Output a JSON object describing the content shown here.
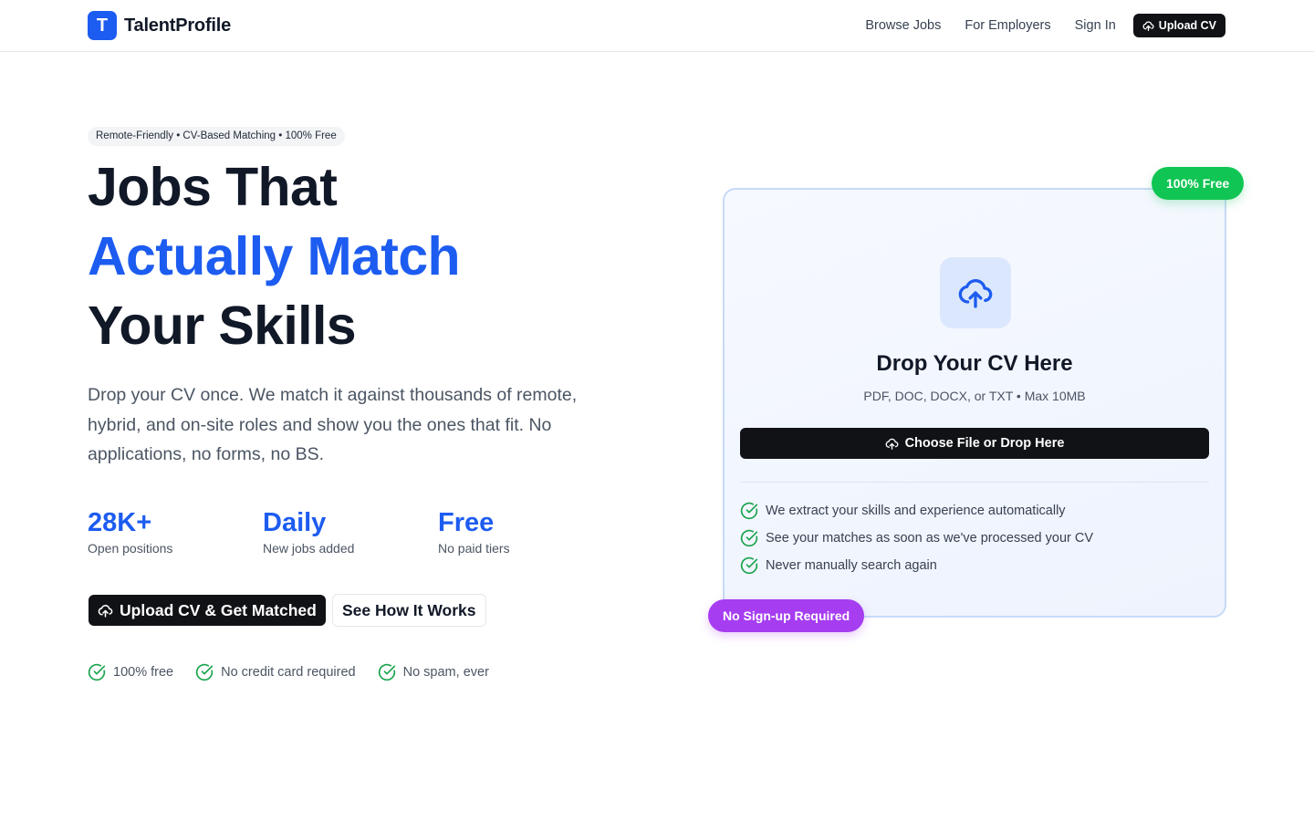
{
  "brand": {
    "logo_letter": "T",
    "name": "TalentProfile",
    "color": "#1d5cf0"
  },
  "nav": {
    "links": [
      "Browse Jobs",
      "For Employers",
      "Sign In"
    ],
    "cta": "Upload CV"
  },
  "hero": {
    "tagline": "Remote-Friendly • CV-Based Matching • 100% Free",
    "headline_line1": "Jobs That",
    "headline_line2": "Actually Match",
    "headline_line3": "Your Skills",
    "lead": "Drop your CV once. We match it against thousands of remote, hybrid, and on-site roles and show you the ones that fit. No applications, no forms, no BS.",
    "stats": [
      {
        "value": "28K+",
        "label": "Open positions"
      },
      {
        "value": "Daily",
        "label": "New jobs added"
      },
      {
        "value": "Free",
        "label": "No paid tiers"
      }
    ],
    "primary_button": "Upload CV & Get Matched",
    "secondary_button": "See How It Works",
    "checks": [
      "100% free",
      "No credit card required",
      "No spam, ever"
    ]
  },
  "upload_card": {
    "title": "Drop Your CV Here",
    "subtitle": "PDF, DOC, DOCX, or TXT • Max 10MB",
    "button": "Choose File or Drop Here",
    "features": [
      "We extract your skills and experience automatically",
      "See your matches as soon as we've processed your CV",
      "Never manually search again"
    ],
    "badge_top": "100% Free",
    "badge_bottom": "No Sign-up Required"
  },
  "colors": {
    "accent": "#1d5cf0",
    "success": "#10c553",
    "purple": "#a63df0",
    "dark": "#111216"
  }
}
